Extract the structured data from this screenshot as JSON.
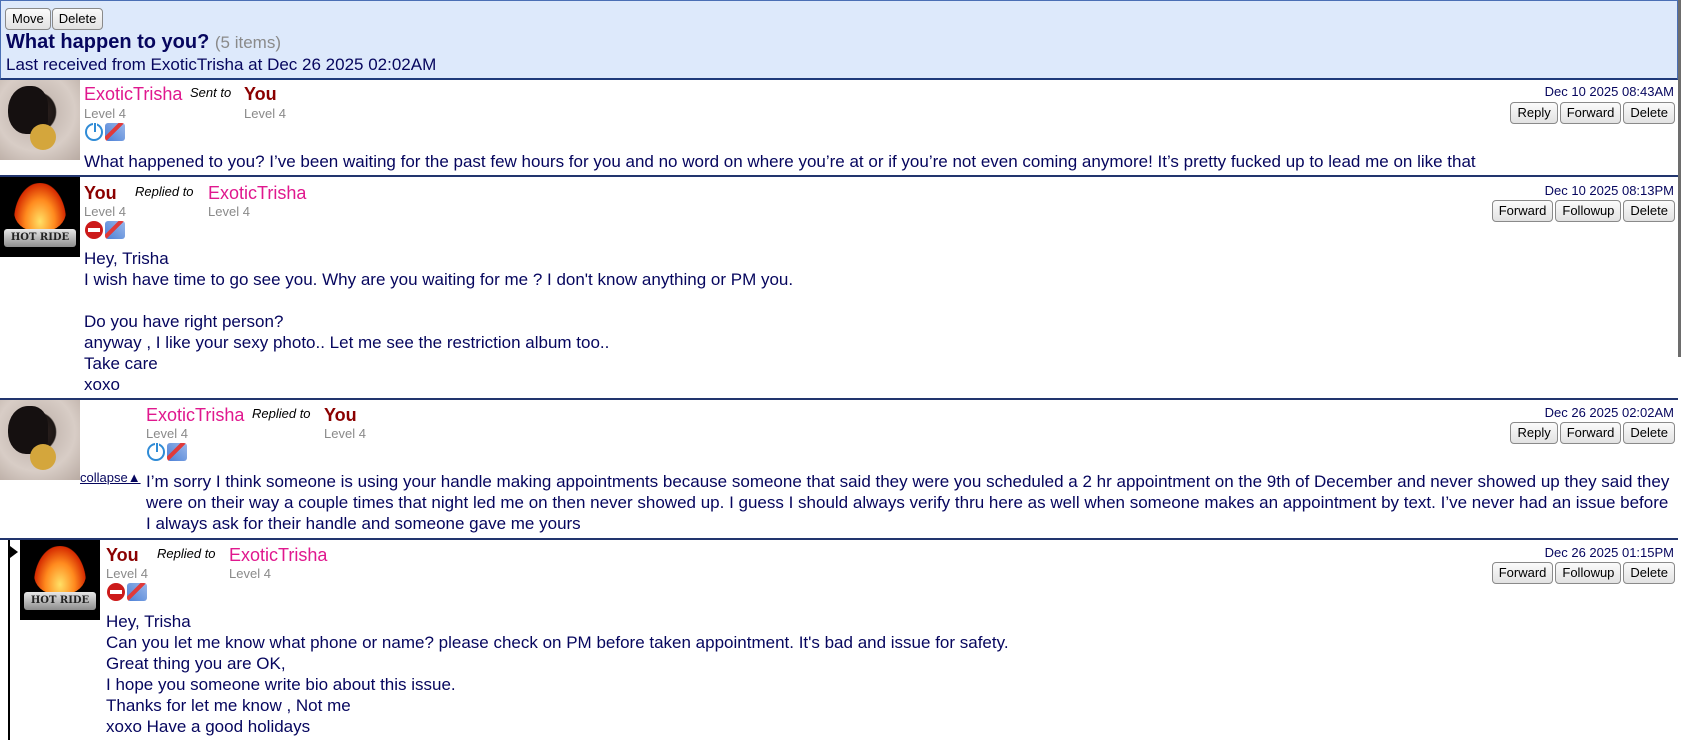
{
  "toolbar": {
    "move_label": "Move",
    "delete_label": "Delete"
  },
  "header": {
    "title": "What happen to you?",
    "count": "(5 items)",
    "last_received": "Last received from ExoticTrisha at Dec 26 2025 02:02AM"
  },
  "messages": [
    {
      "from": "ExoticTrisha",
      "from_level": "Level 4",
      "relation": "Sent to",
      "to": "You",
      "to_level": "Level 4",
      "date": "Dec 10 2025 08:43AM",
      "actions": [
        "Reply",
        "Forward",
        "Delete"
      ],
      "icons": [
        "power-icon",
        "pin-icon"
      ],
      "body": "What happened to you? I’ve been waiting for the past few hours for you and no word on where you’re at or if you’re not even coming anymore! It’s pretty fucked up to lead me on like that"
    },
    {
      "from": "You",
      "from_level": "Level 4",
      "relation": "Replied to",
      "to": "ExoticTrisha",
      "to_level": "Level 4",
      "date": "Dec 10 2025 08:13PM",
      "actions": [
        "Forward",
        "Followup",
        "Delete"
      ],
      "icons": [
        "stop-icon",
        "pin-icon"
      ],
      "avatar_text": "HOT RIDE",
      "body": "Hey, Trisha\nI wish have time to go see you. Why are you waiting for me ? I don't know anything or PM you.\n\nDo you have right person?\nanyway , I like your sexy photo.. Let me see the restriction album too..\nTake care\nxoxo"
    },
    {
      "from": "ExoticTrisha",
      "from_level": "Level 4",
      "relation": "Replied to",
      "to": "You",
      "to_level": "Level 4",
      "date": "Dec 26 2025 02:02AM",
      "actions": [
        "Reply",
        "Forward",
        "Delete"
      ],
      "icons": [
        "power-icon",
        "pin-icon"
      ],
      "collapse_label": "collapse▲",
      "body": "I’m sorry I think someone is using your handle making appointments because someone that said they were you scheduled a 2 hr appointment on the 9th of December and never showed up they said they were on their way a couple times that night led me on then never showed up. I guess I should always verify thru here as well when someone makes an appointment by text. I’ve never had an issue before I always ask for their handle and someone gave me yours"
    },
    {
      "from": "You",
      "from_level": "Level 4",
      "relation": "Replied to",
      "to": "ExoticTrisha",
      "to_level": "Level 4",
      "date": "Dec 26 2025 01:15PM",
      "actions": [
        "Forward",
        "Followup",
        "Delete"
      ],
      "icons": [
        "stop-icon",
        "pin-icon"
      ],
      "avatar_text": "HOT RIDE",
      "body": "Hey, Trisha\nCan you let me know what phone or name? please check on PM before taken appointment. It's bad and issue for safety.\nGreat thing you are OK,\nI hope you someone write bio about this issue.\nThanks for let me know , Not me\nxoxo Have a good holidays"
    }
  ]
}
